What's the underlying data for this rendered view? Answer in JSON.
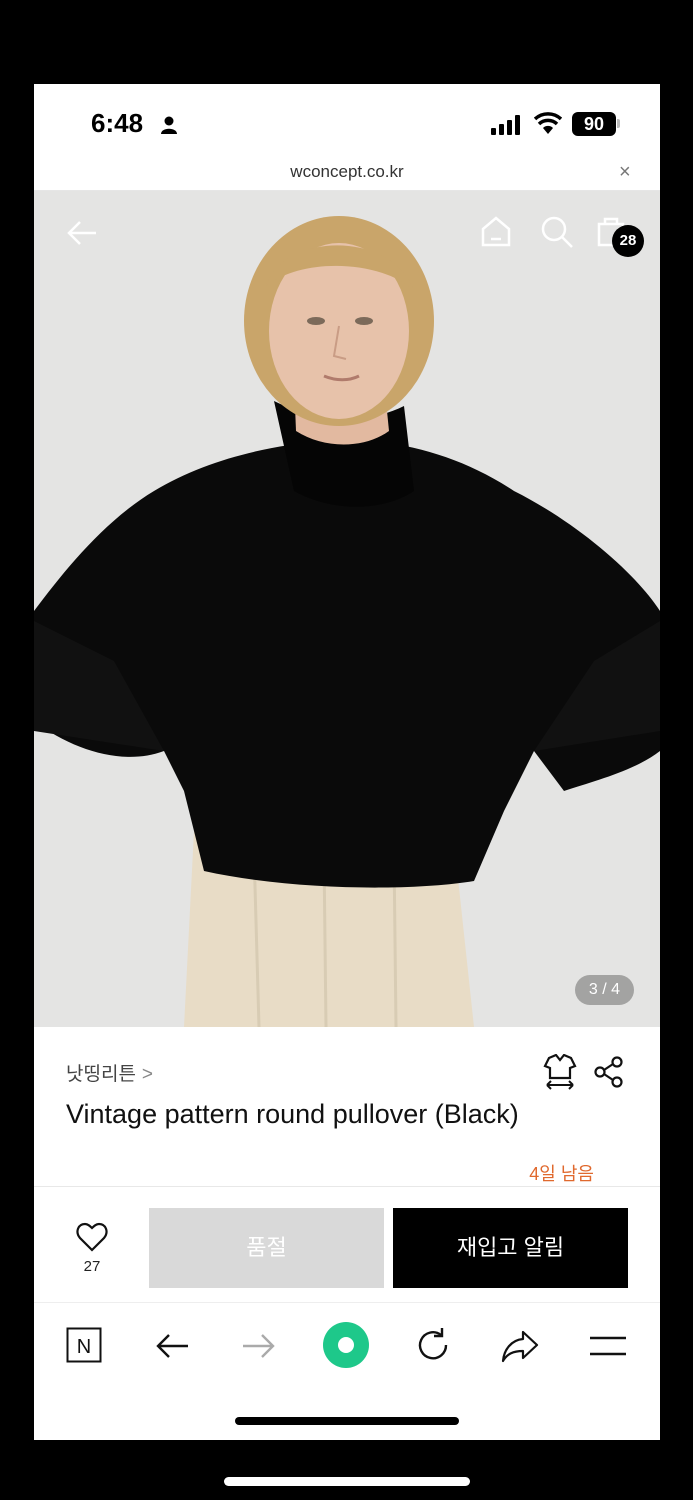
{
  "status_bar": {
    "time": "6:48",
    "battery": "90"
  },
  "browser": {
    "url": "wconcept.co.kr",
    "close_label": "×"
  },
  "header": {
    "cart_count": "28"
  },
  "gallery": {
    "counter": "3 / 4"
  },
  "product": {
    "brand": "낫띵리튼",
    "brand_chevron": ">",
    "title": "Vintage pattern round pullover (Black)",
    "days_left": "4일 남음"
  },
  "actions": {
    "like_count": "27",
    "sold_out_label": "품절",
    "restock_label": "재입고 알림"
  },
  "toolbar": {
    "n_label": "N"
  },
  "icons": [
    "person-icon",
    "signal-icon",
    "wifi-icon",
    "back-arrow-icon",
    "home-icon",
    "search-icon",
    "shopping-bag-icon",
    "fit-icon",
    "share-icon",
    "heart-icon",
    "back-icon",
    "forward-icon",
    "reload-icon",
    "share-arrow-icon",
    "menu-icon"
  ],
  "colors": {
    "accent_orange": "#e0692e",
    "green": "#1ec88a",
    "black": "#000000",
    "soldout_gray": "#d9d9d9"
  }
}
